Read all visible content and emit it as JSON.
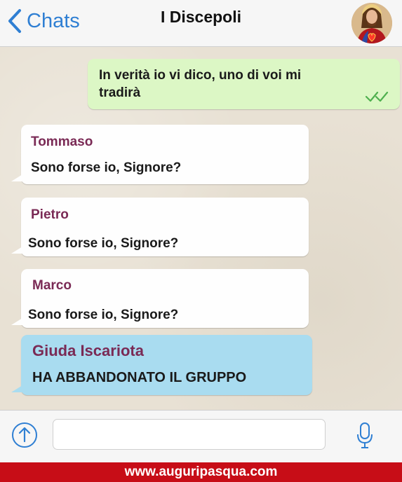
{
  "header": {
    "back_label": "Chats",
    "title": "I Discepoli",
    "avatar_icon": "jesus-sacred-heart-avatar"
  },
  "messages": [
    {
      "direction": "outgoing",
      "text_line1": "In verità io vi dico, uno di voi mi",
      "text_line2": "tradirà",
      "status_icon": "double-check-icon",
      "status_color": "#4fb04f"
    },
    {
      "direction": "incoming",
      "sender": "Tommaso",
      "text": "Sono forse io, Signore?"
    },
    {
      "direction": "incoming",
      "sender": "Pietro",
      "text": "Sono forse io, Signore?"
    },
    {
      "direction": "incoming",
      "sender": "Marco",
      "text": "Sono forse io, Signore?"
    },
    {
      "direction": "incoming",
      "sender": "Giuda Iscariota",
      "text": "HA ABBANDONATO IL GRUPPO",
      "highlight_color": "#a9dcf0"
    }
  ],
  "input_bar": {
    "upload_icon": "upload-arrow-icon",
    "message_placeholder": "",
    "mic_icon": "microphone-icon"
  },
  "footer": {
    "text": "www.auguripasqua.com",
    "background": "#c70d17"
  }
}
